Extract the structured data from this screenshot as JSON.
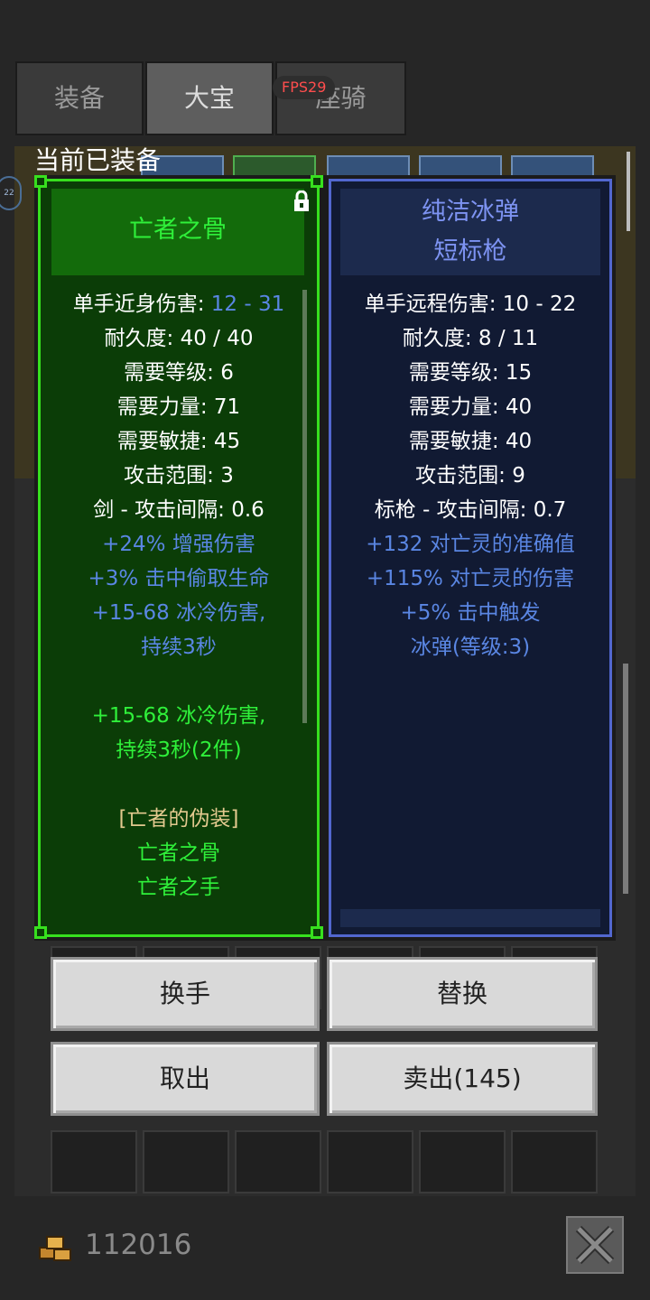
{
  "tabs": [
    "装备",
    "大宝",
    "座骑"
  ],
  "fps": "FPS29",
  "equipped_label": "当前已装备",
  "left_item": {
    "title": "亡者之骨",
    "stats": [
      {
        "label": "单手近身伤害: ",
        "value": "12 - 31"
      },
      {
        "text": "耐久度: 40 / 40"
      },
      {
        "text": "需要等级: 6"
      },
      {
        "text": "需要力量: 71"
      },
      {
        "text": "需要敏捷: 45"
      },
      {
        "text": "攻击范围: 3"
      },
      {
        "text": "剑 - 攻击间隔: 0.6"
      }
    ],
    "magic": [
      "+24% 增强伤害",
      "+3% 击中偷取生命",
      "+15-68 冰冷伤害,",
      "持续3秒"
    ],
    "set_bonus": [
      "+15-68 冰冷伤害,",
      "持续3秒(2件)"
    ],
    "set_name": "[亡者的伪装]",
    "set_items": [
      "亡者之骨",
      "亡者之手"
    ]
  },
  "right_item": {
    "title_line1": "纯洁冰弹",
    "title_line2": "短标枪",
    "stats": [
      "单手远程伤害: 10 - 22",
      "耐久度: 8 / 11",
      "需要等级: 15",
      "需要力量: 40",
      "需要敏捷: 40",
      "攻击范围: 9",
      "标枪 - 攻击间隔: 0.7"
    ],
    "magic": [
      "+132 对亡灵的准确值",
      "+115% 对亡灵的伤害",
      "+5% 击中触发",
      "冰弹(等级:3)"
    ]
  },
  "buttons": {
    "swap_hand": "换手",
    "replace": "替换",
    "take_out": "取出",
    "sell": "卖出(145)"
  },
  "gold": "112016",
  "icons": {
    "gold": "gold-coins-icon",
    "close": "close-icon",
    "lock": "lock-icon"
  },
  "colors": {
    "green_border": "#37e01e",
    "blue_border": "#5267cf",
    "magic_blue": "#5a86e3",
    "set_green": "#2ff03a"
  }
}
